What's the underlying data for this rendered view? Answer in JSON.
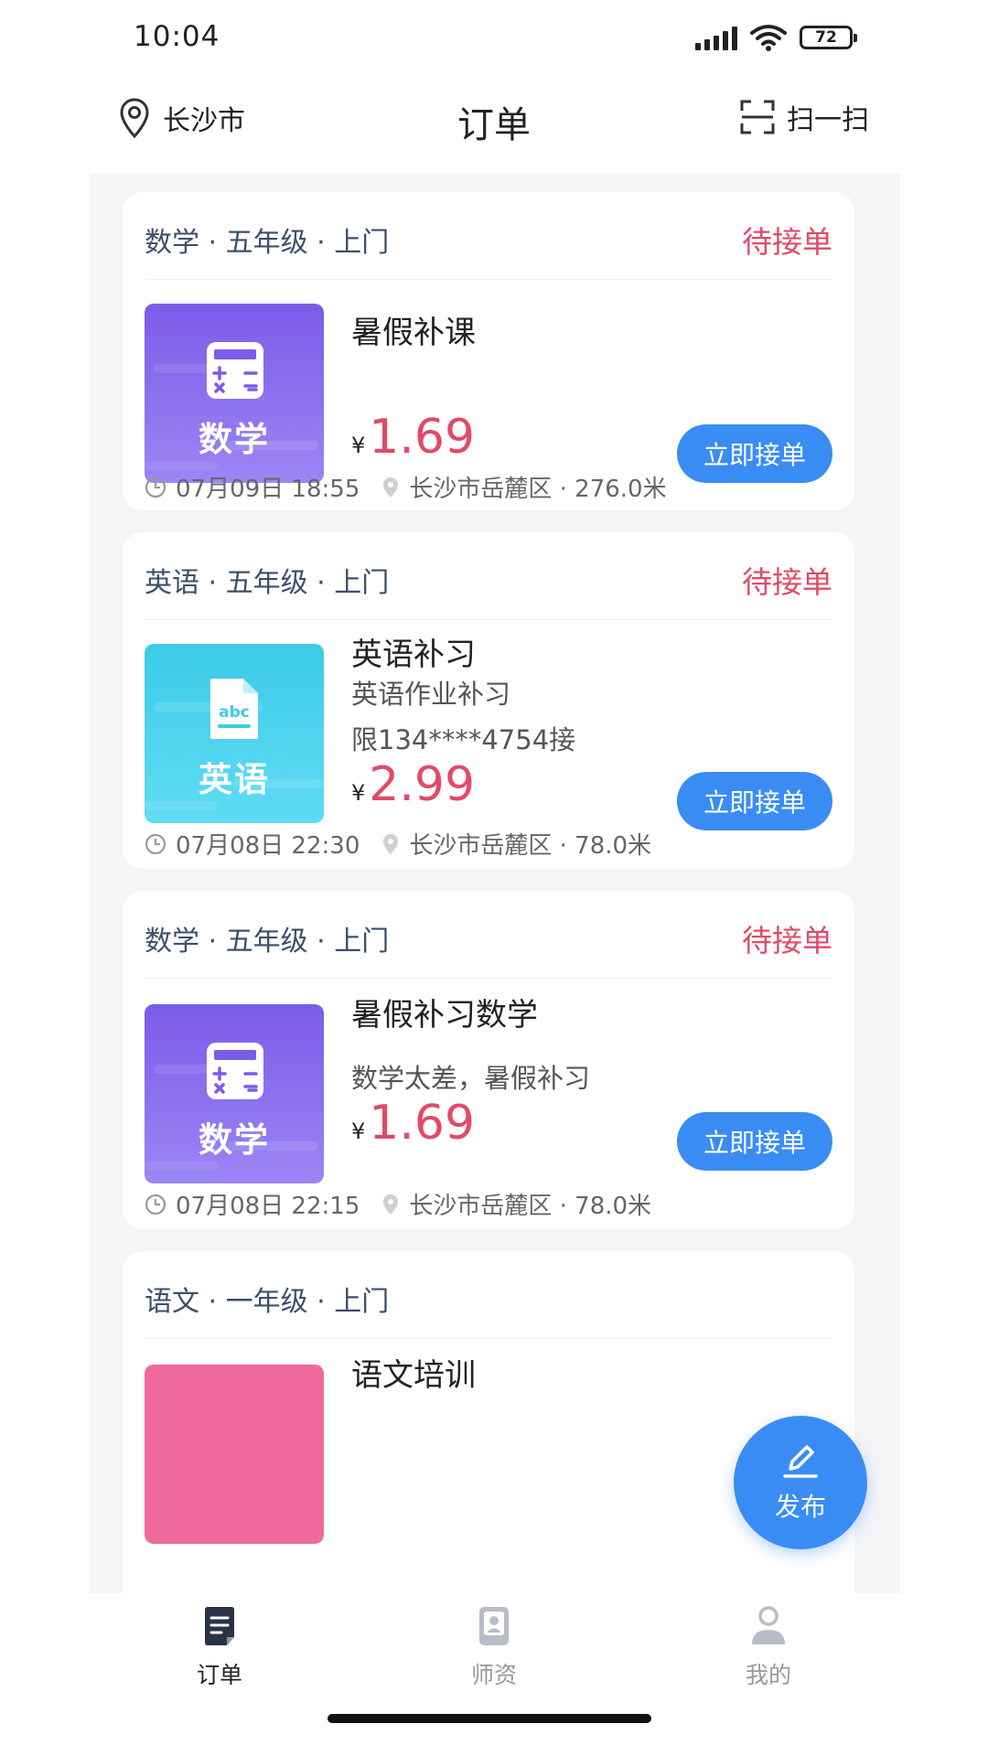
{
  "status_bar": {
    "time": "10:04",
    "battery": "72"
  },
  "header": {
    "location": "长沙市",
    "title": "订单",
    "scan_label": "扫一扫"
  },
  "orders": [
    {
      "tags": "数学 · 五年级 · 上门",
      "status": "待接单",
      "thumb_label": "数学",
      "thumb_icon": "calculator-icon",
      "title": "暑假补课",
      "desc": "",
      "restrict": "",
      "currency": "¥",
      "price": "1.69",
      "accept_label": "立即接单",
      "datetime": "07月09日 18:55",
      "place": "长沙市岳麓区 · 276.0米"
    },
    {
      "tags": "英语 · 五年级 · 上门",
      "status": "待接单",
      "thumb_label": "英语",
      "thumb_icon": "abc-document-icon",
      "title": "英语补习",
      "desc": "英语作业补习",
      "restrict": "限134****4754接",
      "currency": "¥",
      "price": "2.99",
      "accept_label": "立即接单",
      "datetime": "07月08日 22:30",
      "place": "长沙市岳麓区 · 78.0米"
    },
    {
      "tags": "数学 · 五年级 · 上门",
      "status": "待接单",
      "thumb_label": "数学",
      "thumb_icon": "calculator-icon",
      "title": "暑假补习数学",
      "desc": "数学太差，暑假补习",
      "restrict": "",
      "currency": "¥",
      "price": "1.69",
      "accept_label": "立即接单",
      "datetime": "07月08日 22:15",
      "place": "长沙市岳麓区 · 78.0米"
    },
    {
      "tags": "语文 · 一年级 · 上门",
      "title": "语文培训"
    }
  ],
  "fab": {
    "label": "发布",
    "icon": "edit-pen-icon"
  },
  "bottom_nav": [
    {
      "label": "订单",
      "icon": "order-list-icon",
      "active": true
    },
    {
      "label": "师资",
      "icon": "teacher-profile-icon",
      "active": false
    },
    {
      "label": "我的",
      "icon": "user-icon",
      "active": false
    }
  ],
  "colors": {
    "accent": "#3a8cf5",
    "status": "#e34968",
    "math_thumb": "#8a6cf0",
    "english_thumb": "#49d4ef",
    "chinese_thumb": "#ef6a9c"
  }
}
